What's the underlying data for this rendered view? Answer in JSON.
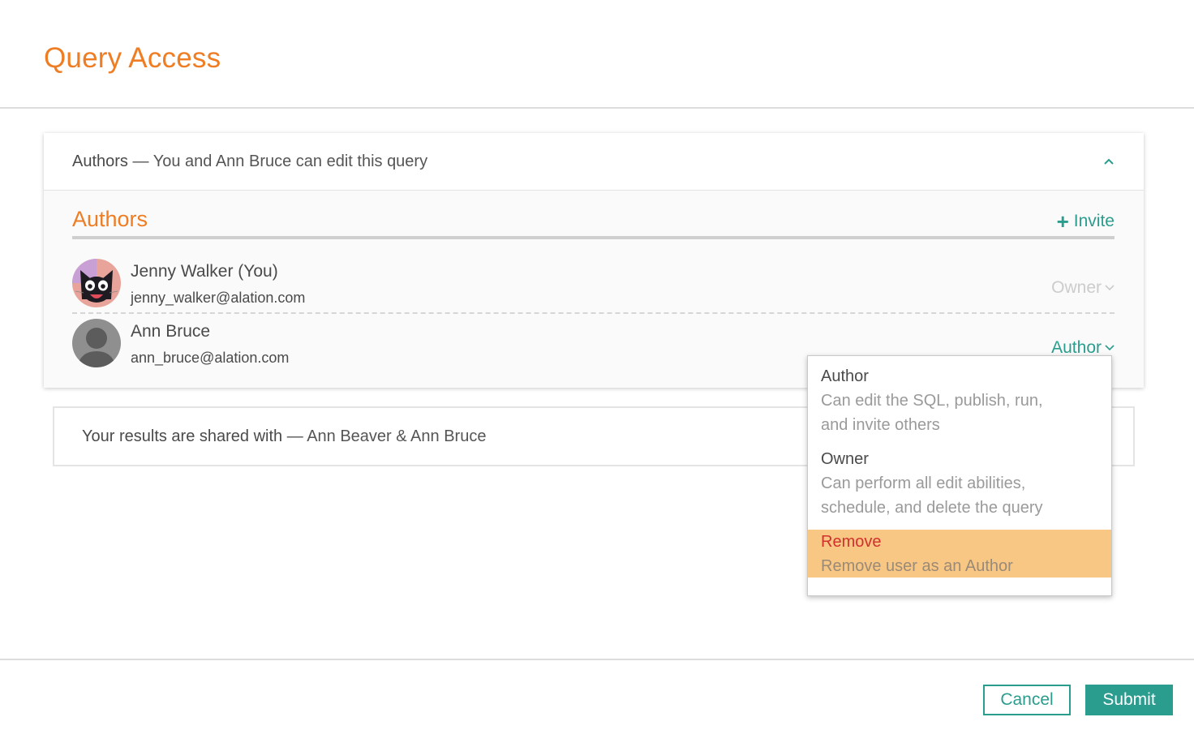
{
  "page": {
    "title": "Query Access"
  },
  "authors_card": {
    "header_label": "Authors",
    "header_sep": " — ",
    "header_detail": "You and Ann Bruce can edit this query",
    "section_title": "Authors",
    "invite_label": "Invite",
    "users": [
      {
        "name": "Jenny Walker (You)",
        "email": "jenny_walker@alation.com",
        "role": "Owner"
      },
      {
        "name": "Ann Bruce",
        "email": "ann_bruce@alation.com",
        "role": "Author"
      }
    ]
  },
  "shared_card": {
    "label": "Your results are shared with",
    "sep": " — ",
    "detail": "Ann Beaver & Ann Bruce"
  },
  "role_dropdown": {
    "items": [
      {
        "title": "Author",
        "desc_line1": "Can edit the SQL, publish, run,",
        "desc_line2": "and invite others"
      },
      {
        "title": "Owner",
        "desc_line1": "Can perform all edit abilities,",
        "desc_line2": "schedule, and delete the query"
      },
      {
        "title": "Remove",
        "desc_line1": "Remove user as an Author"
      }
    ]
  },
  "footer": {
    "cancel_label": "Cancel",
    "submit_label": "Submit"
  },
  "colors": {
    "accent_orange": "#ee7d23",
    "accent_teal": "#2a9d8f",
    "highlight": "#f9c784",
    "danger": "#d0312d"
  }
}
